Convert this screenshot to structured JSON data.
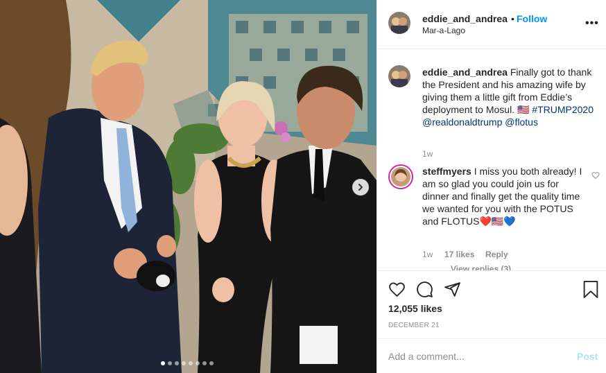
{
  "post": {
    "username": "eddie_and_andrea",
    "separator": "•",
    "follow_label": "Follow",
    "location": "Mar-a-Lago",
    "more_icon": "more-horizontal-icon",
    "more_label": "•••"
  },
  "caption": {
    "username": "eddie_and_andrea",
    "text": "Finally got to thank the President and his amazing wife by giving them a little gift from Eddie’s deployment to Mosul. 🇺🇸",
    "hashtag": "#TRUMP2020",
    "mention_1": "@realdonaldtrump",
    "mention_2": "@flotus",
    "time": "1w"
  },
  "comment": {
    "username": "steffmyers",
    "text": "I miss you both already! I am so glad you could join us for dinner and finally get the quality time we wanted for you with the POTUS and FLOTUS❤️🇺🇸💙",
    "time": "1w",
    "likes": "17 likes",
    "reply_label": "Reply",
    "view_replies": "View replies (3)"
  },
  "actions": {
    "likes_count": "12,055 likes",
    "date": "DECEMBER 21"
  },
  "add_comment": {
    "placeholder": "Add a comment...",
    "post_label": "Post"
  },
  "carousel": {
    "slide_count": 8,
    "active_index": 0
  },
  "colors": {
    "accent": "#0095f6",
    "post_disabled": "#b2dffc",
    "muted": "#8e8e8e",
    "text": "#262626",
    "link": "#00376b"
  }
}
